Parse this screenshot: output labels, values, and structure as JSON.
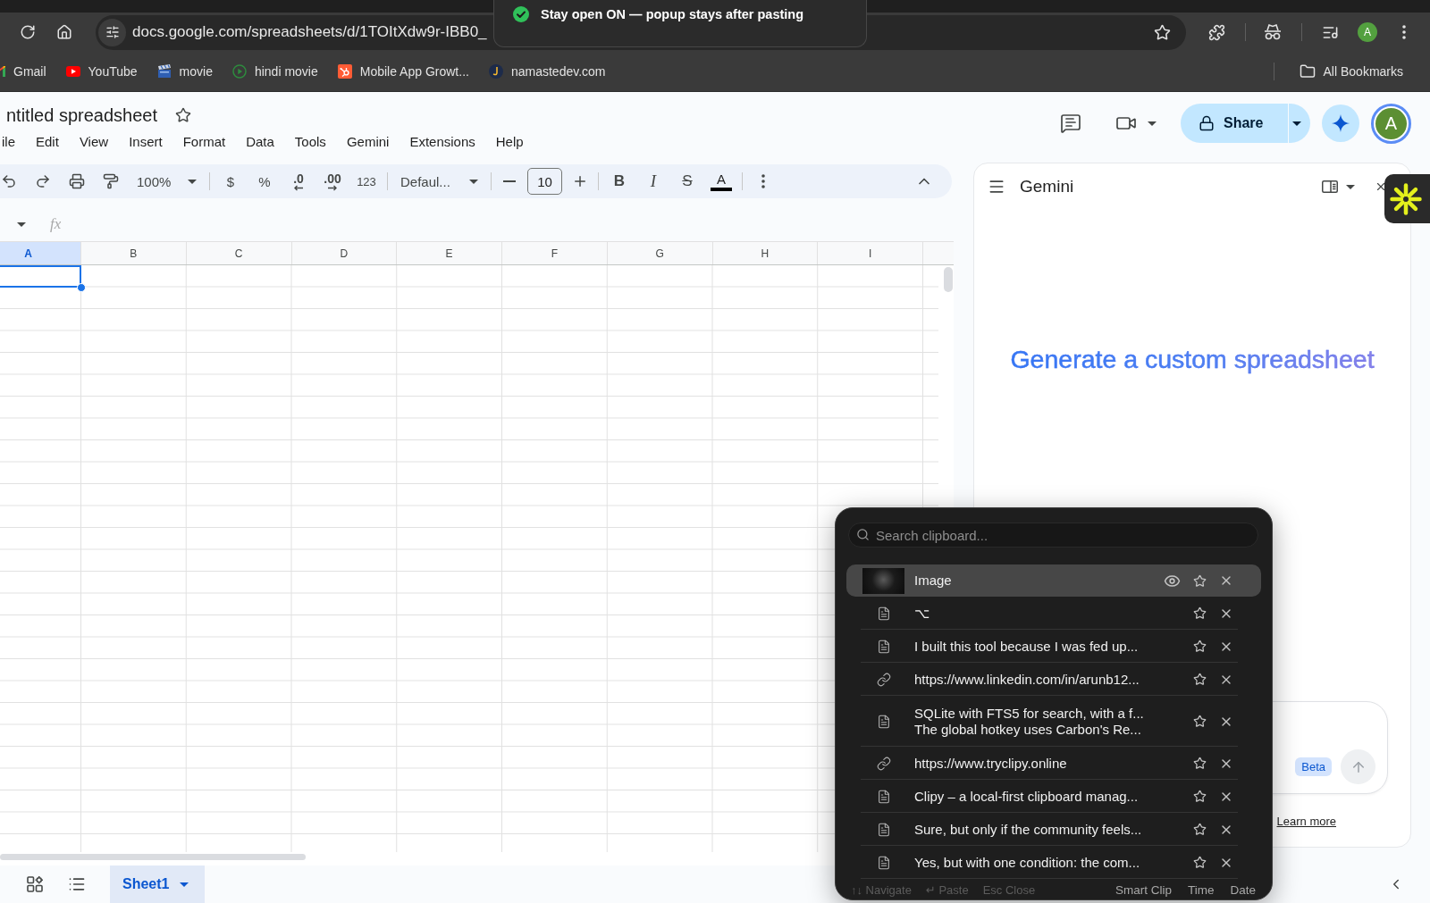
{
  "browser": {
    "address": "docs.google.com/spreadsheets/d/1TOItXdw9r-IBB0_",
    "profile_initial": "A",
    "bookmarks": [
      {
        "kind": "mail",
        "label": "Gmail"
      },
      {
        "kind": "video",
        "label": "YouTube"
      },
      {
        "kind": "clapper",
        "label": "movie"
      },
      {
        "kind": "play",
        "label": "hindi movie"
      },
      {
        "kind": "sprocket",
        "label": "Mobile App Growt..."
      },
      {
        "kind": "round",
        "label": "namastedev.com"
      }
    ],
    "all_bookmarks": "All Bookmarks"
  },
  "toast": {
    "text": "Stay open ON — popup stays after pasting"
  },
  "document": {
    "title": "ntitled spreadsheet",
    "menu": [
      "ile",
      "Edit",
      "View",
      "Insert",
      "Format",
      "Data",
      "Tools",
      "Gemini",
      "Extensions",
      "Help"
    ]
  },
  "header": {
    "share": "Share",
    "avatar": "A"
  },
  "toolbar": {
    "zoom": "100%",
    "currency": "$",
    "percent": "%",
    "decrease_decimal": ".0",
    "increase_decimal": ".00",
    "number_format": "123",
    "font": "Defaul...",
    "font_size": "10",
    "bold": "B",
    "italic": "I",
    "strikethrough": "S",
    "text_color": "A"
  },
  "formula_bar": {
    "label": "fx"
  },
  "grid": {
    "columns": [
      {
        "label": "A",
        "selected": true
      },
      {
        "label": "B",
        "selected": false
      },
      {
        "label": "C",
        "selected": false
      },
      {
        "label": "D",
        "selected": false
      },
      {
        "label": "E",
        "selected": false
      },
      {
        "label": "F",
        "selected": false
      },
      {
        "label": "G",
        "selected": false
      },
      {
        "label": "H",
        "selected": false
      },
      {
        "label": "I",
        "selected": false
      }
    ]
  },
  "sheets": [
    {
      "name": "Sheet1",
      "selected": true
    }
  ],
  "gemini": {
    "title": "Gemini",
    "headline": "Generate a custom spreadsheet",
    "badge": "Beta",
    "link": "Learn more"
  },
  "clipboard": {
    "search_placeholder": "Search clipboard...",
    "items": [
      {
        "kind": "image",
        "lines": [
          "Image"
        ],
        "selected": true
      },
      {
        "kind": "text",
        "lines": [
          "⌥"
        ],
        "selected": false
      },
      {
        "kind": "text",
        "lines": [
          "I built this tool because I was fed up..."
        ],
        "selected": false
      },
      {
        "kind": "link",
        "lines": [
          "https://www.linkedin.com/in/arunb12..."
        ],
        "selected": false
      },
      {
        "kind": "text",
        "lines": [
          "SQLite with FTS5 for search, with a f...",
          "The global hotkey uses Carbon's Re..."
        ],
        "selected": false
      },
      {
        "kind": "link",
        "lines": [
          "https://www.tryclipy.online"
        ],
        "selected": false
      },
      {
        "kind": "text",
        "lines": [
          "Clipy – a local-first clipboard manag..."
        ],
        "selected": false
      },
      {
        "kind": "text",
        "lines": [
          "Sure, but only if the community feels..."
        ],
        "selected": false
      },
      {
        "kind": "text",
        "lines": [
          "Yes, but with one condition: the com..."
        ],
        "selected": false
      }
    ],
    "hints": [
      "↑↓ Navigate",
      "↵ Paste",
      "Esc Close"
    ],
    "sort_options": [
      "Smart Clip",
      "Time",
      "Date"
    ]
  }
}
